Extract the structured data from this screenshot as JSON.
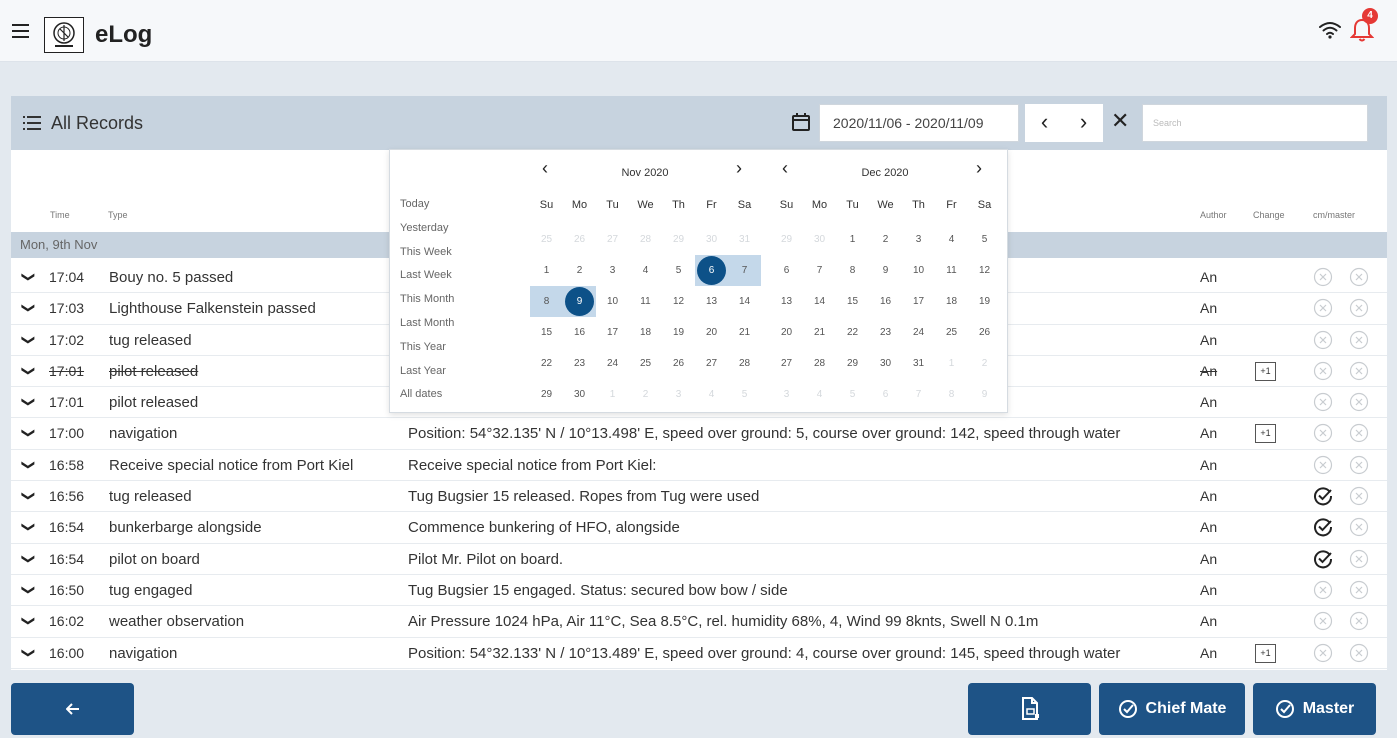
{
  "app": {
    "title": "eLog",
    "notification_count": "4"
  },
  "panel": {
    "title": "All Records",
    "date_range": "2020/11/06 - 2020/11/09",
    "search_placeholder": "Search",
    "columns": {
      "time": "Time",
      "type": "Type",
      "author": "Author",
      "change": "Change",
      "cm_master": "cm/master"
    },
    "group_label": "Mon, 9th Nov"
  },
  "calendar": {
    "presets": [
      "Today",
      "Yesterday",
      "This Week",
      "Last Week",
      "This Month",
      "Last Month",
      "This Year",
      "Last Year",
      "All dates"
    ],
    "weekdays": [
      "Su",
      "Mo",
      "Tu",
      "We",
      "Th",
      "Fr",
      "Sa"
    ],
    "months": [
      {
        "title": "Nov 2020",
        "weeks": [
          [
            "25",
            "26",
            "27",
            "28",
            "29",
            "30",
            "31"
          ],
          [
            "1",
            "2",
            "3",
            "4",
            "5",
            "6",
            "7"
          ],
          [
            "8",
            "9",
            "10",
            "11",
            "12",
            "13",
            "14"
          ],
          [
            "15",
            "16",
            "17",
            "18",
            "19",
            "20",
            "21"
          ],
          [
            "22",
            "23",
            "24",
            "25",
            "26",
            "27",
            "28"
          ],
          [
            "29",
            "30",
            "1",
            "2",
            "3",
            "4",
            "5"
          ]
        ]
      },
      {
        "title": "Dec 2020",
        "weeks": [
          [
            "29",
            "30",
            "1",
            "2",
            "3",
            "4",
            "5"
          ],
          [
            "6",
            "7",
            "8",
            "9",
            "10",
            "11",
            "12"
          ],
          [
            "13",
            "14",
            "15",
            "16",
            "17",
            "18",
            "19"
          ],
          [
            "20",
            "21",
            "22",
            "23",
            "24",
            "25",
            "26"
          ],
          [
            "27",
            "28",
            "29",
            "30",
            "31",
            "1",
            "2"
          ],
          [
            "3",
            "4",
            "5",
            "6",
            "7",
            "8",
            "9"
          ]
        ]
      }
    ]
  },
  "records": [
    {
      "time": "17:04",
      "type": "Bouy no. 5 passed",
      "description": "",
      "author": "An",
      "change": "",
      "cm_signed": false,
      "struck": false
    },
    {
      "time": "17:03",
      "type": "Lighthouse Falkenstein passed",
      "description": "",
      "author": "An",
      "change": "",
      "cm_signed": false,
      "struck": false
    },
    {
      "time": "17:02",
      "type": "tug released",
      "description": "",
      "author": "An",
      "change": "",
      "cm_signed": false,
      "struck": false
    },
    {
      "time": "17:01",
      "type": "pilot released",
      "description": "",
      "author": "An",
      "change": "+1",
      "cm_signed": false,
      "struck": true
    },
    {
      "time": "17:01",
      "type": "pilot released",
      "description": "",
      "author": "An",
      "change": "",
      "cm_signed": false,
      "struck": false
    },
    {
      "time": "17:00",
      "type": "navigation",
      "description": "Position: 54°32.135' N / 10°13.498' E, speed over ground: 5, course over ground: 142, speed through water",
      "author": "An",
      "change": "+1",
      "cm_signed": false,
      "struck": false
    },
    {
      "time": "16:58",
      "type": "Receive special notice from Port Kiel",
      "description": "Receive special notice from Port Kiel:",
      "author": "An",
      "change": "",
      "cm_signed": false,
      "struck": false
    },
    {
      "time": "16:56",
      "type": "tug released",
      "description": "Tug Bugsier 15 released. Ropes from Tug were used",
      "author": "An",
      "change": "",
      "cm_signed": true,
      "struck": false
    },
    {
      "time": "16:54",
      "type": "bunkerbarge alongside",
      "description": "Commence bunkering of HFO, alongside",
      "author": "An",
      "change": "",
      "cm_signed": true,
      "struck": false
    },
    {
      "time": "16:54",
      "type": "pilot on board",
      "description": "Pilot Mr. Pilot on board.",
      "author": "An",
      "change": "",
      "cm_signed": true,
      "struck": false
    },
    {
      "time": "16:50",
      "type": "tug engaged",
      "description": "Tug Bugsier 15 engaged. Status: secured bow bow / side",
      "author": "An",
      "change": "",
      "cm_signed": false,
      "struck": false
    },
    {
      "time": "16:02",
      "type": "weather observation",
      "description": "Air Pressure 1024 hPa, Air 11°C, Sea 8.5°C, rel. humidity 68%, 4, Wind 99 8knts, Swell N 0.1m",
      "author": "An",
      "change": "",
      "cm_signed": false,
      "struck": false
    },
    {
      "time": "16:00",
      "type": "navigation",
      "description": "Position: 54°32.133' N / 10°13.489' E, speed over ground: 4, course over ground: 145, speed through water",
      "author": "An",
      "change": "+1",
      "cm_signed": false,
      "struck": false
    }
  ],
  "buttons": {
    "chief_mate": "Chief Mate",
    "master": "Master"
  },
  "colors": {
    "primary": "#1e5386",
    "header": "#c7d3df",
    "selected_day": "#0d5188",
    "range_day": "#c4d8ea",
    "badge": "#e53935"
  }
}
